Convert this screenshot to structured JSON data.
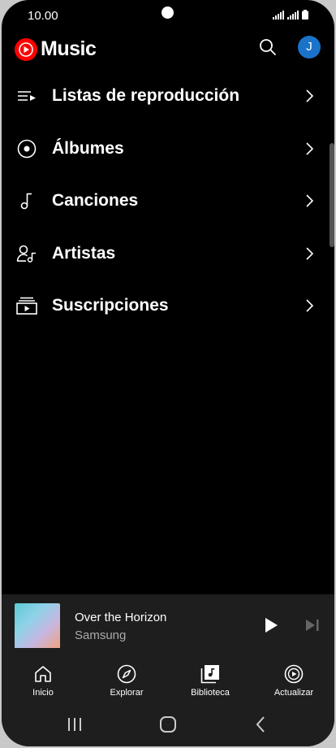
{
  "status_bar": {
    "time": "10.00"
  },
  "header": {
    "app_name": "Music",
    "avatar_letter": "J"
  },
  "menu": {
    "items": [
      {
        "label": "Listas de reproducción",
        "icon": "playlist-icon"
      },
      {
        "label": "Álbumes",
        "icon": "album-icon"
      },
      {
        "label": "Canciones",
        "icon": "music-note-icon"
      },
      {
        "label": "Artistas",
        "icon": "artist-icon"
      },
      {
        "label": "Suscripciones",
        "icon": "subscriptions-icon"
      }
    ]
  },
  "player": {
    "title": "Over the Horizon",
    "artist": "Samsung"
  },
  "nav": {
    "items": [
      {
        "label": "Inicio",
        "icon": "home-icon"
      },
      {
        "label": "Explorar",
        "icon": "compass-icon"
      },
      {
        "label": "Biblioteca",
        "icon": "library-icon"
      },
      {
        "label": "Actualizar",
        "icon": "upgrade-icon"
      }
    ],
    "active_index": 2
  },
  "colors": {
    "background": "#000000",
    "brand_red": "#ff0000",
    "avatar_blue": "#1a73c9",
    "surface": "#1e1e1e"
  }
}
